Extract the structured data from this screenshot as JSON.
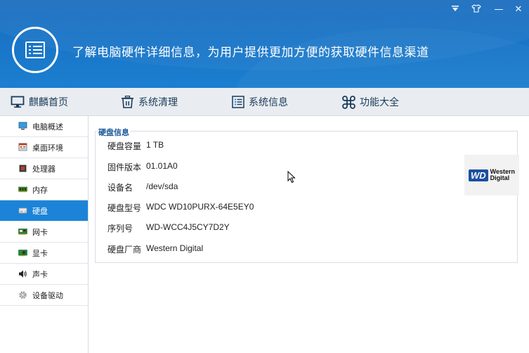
{
  "header": {
    "slogan": "了解电脑硬件详细信息，为用户提供更加方便的获取硬件信息渠道",
    "window_controls": [
      "menu-icon",
      "skin-icon",
      "minimize-icon",
      "close-icon"
    ],
    "minimize_glyph": "—",
    "close_glyph": "✕"
  },
  "nav": {
    "home": "麒麟首页",
    "clean": "系统清理",
    "info": "系统信息",
    "all": "功能大全"
  },
  "sidebar": {
    "items": [
      {
        "label": "电脑概述",
        "icon": "monitor-icon"
      },
      {
        "label": "桌面环境",
        "icon": "desktop-icon"
      },
      {
        "label": "处理器",
        "icon": "cpu-icon"
      },
      {
        "label": "内存",
        "icon": "memory-icon"
      },
      {
        "label": "硬盘",
        "icon": "disk-icon",
        "active": true
      },
      {
        "label": "网卡",
        "icon": "network-card-icon"
      },
      {
        "label": "显卡",
        "icon": "graphics-card-icon"
      },
      {
        "label": "声卡",
        "icon": "speaker-icon"
      },
      {
        "label": "设备驱动",
        "icon": "gear-icon"
      }
    ]
  },
  "disk_panel": {
    "title": "硬盘信息",
    "rows": [
      {
        "key": "硬盘容量",
        "value": "1 TB"
      },
      {
        "key": "固件版本",
        "value": "01.01A0"
      },
      {
        "key": "设备名",
        "value": "/dev/sda"
      },
      {
        "key": "硬盘型号",
        "value": "WDC WD10PURX-64E5EY0"
      },
      {
        "key": "序列号",
        "value": "WD-WCC4J5CY7D2Y"
      },
      {
        "key": "硬盘厂商",
        "value": "Western Digital"
      }
    ],
    "vendor_logo": {
      "badge": "WD",
      "line1": "Western",
      "line2": "Digital"
    }
  },
  "colors": {
    "header_blue": "#1976c8",
    "active_blue": "#1b84d8",
    "nav_bg": "#e9edf1"
  }
}
